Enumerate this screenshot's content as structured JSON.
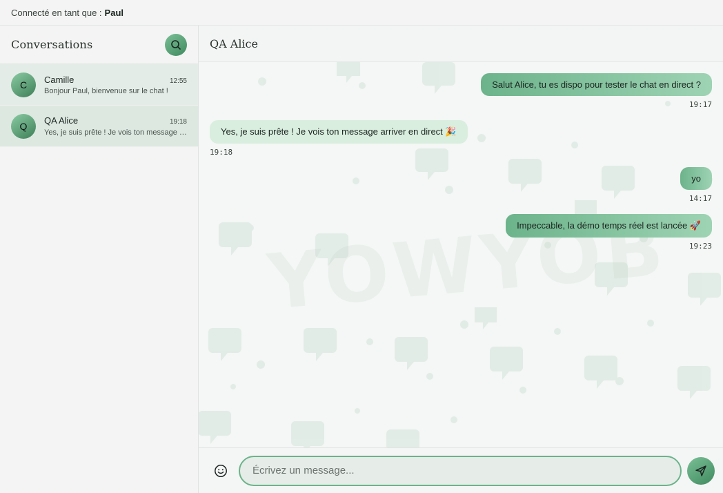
{
  "topbar": {
    "prefix": "Connecté en tant que :",
    "user": "Paul"
  },
  "sidebar": {
    "title": "Conversations",
    "search_icon": "search-icon",
    "conversations": [
      {
        "initial": "C",
        "name": "Camille",
        "time": "12:55",
        "preview": "Bonjour Paul, bienvenue sur le chat !"
      },
      {
        "initial": "Q",
        "name": "QA Alice",
        "time": "19:18",
        "preview": "Yes, je suis prête ! Je vois ton message arriver en direct 🎉"
      }
    ]
  },
  "chat": {
    "title": "QA Alice",
    "watermark": "YOWYOB",
    "messages": [
      {
        "direction": "out",
        "text": "Salut Alice, tu es dispo pour tester le chat en direct ?",
        "time": "19:17"
      },
      {
        "direction": "in",
        "text": "Yes, je suis prête ! Je vois ton message arriver en direct 🎉",
        "time": "19:18"
      },
      {
        "direction": "out",
        "text": "yo",
        "time": "14:17"
      },
      {
        "direction": "out",
        "text": "Impeccable, la démo temps réel est lancée 🚀",
        "time": "19:23"
      }
    ]
  },
  "composer": {
    "placeholder": "Écrivez un message...",
    "emoji_icon": "smiley-icon",
    "send_icon": "send-icon"
  },
  "colors": {
    "accent": "#6bb38a",
    "accent_dark": "#3f8a5e",
    "bubble_in": "#d9eede"
  }
}
